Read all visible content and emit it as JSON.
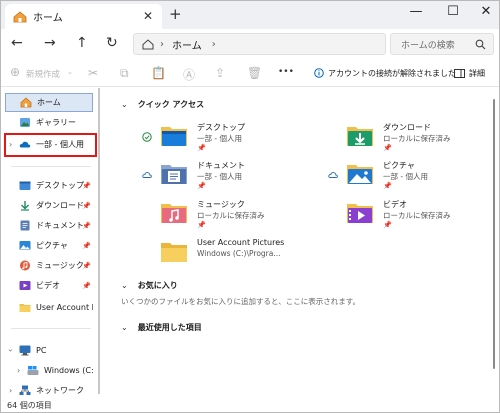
{
  "window": {
    "tab_title": "ホーム",
    "new_tab": "+",
    "minimize": "—",
    "maximize": "☐",
    "close": "✕"
  },
  "nav": {
    "back": "←",
    "forward": "→",
    "up": "↑",
    "refresh": "↻",
    "breadcrumb_root": "ホーム",
    "breadcrumb_sep": "›",
    "search_placeholder": "ホームの検索"
  },
  "command": {
    "new_label": "新規作成",
    "more": "•••",
    "status_msg": "アカウントの接続が解除されました",
    "details_label": "詳細"
  },
  "sidebar": {
    "home": "ホーム",
    "gallery": "ギャラリー",
    "onedrive": "一部 - 個人用",
    "quick": [
      {
        "label": "デスクトップ",
        "icon": "desktop-icon"
      },
      {
        "label": "ダウンロード",
        "icon": "download-icon"
      },
      {
        "label": "ドキュメント",
        "icon": "document-icon"
      },
      {
        "label": "ピクチャ",
        "icon": "picture-icon"
      },
      {
        "label": "ミュージック",
        "icon": "music-icon"
      },
      {
        "label": "ビデオ",
        "icon": "video-icon"
      },
      {
        "label": "User Account Pic",
        "icon": "folder-icon"
      }
    ],
    "pc": "PC",
    "windows_drive": "Windows (C:)",
    "network": "ネットワーク"
  },
  "main": {
    "quick_access": "クイック アクセス",
    "items": [
      {
        "name": "デスクトップ",
        "sub": "一部 - 個人用",
        "status": "check"
      },
      {
        "name": "ダウンロード",
        "sub": "ローカルに保存済み",
        "status": "none"
      },
      {
        "name": "ドキュメント",
        "sub": "一部 - 個人用",
        "status": "cloud"
      },
      {
        "name": "ピクチャ",
        "sub": "一部 - 個人用",
        "status": "cloud"
      },
      {
        "name": "ミュージック",
        "sub": "ローカルに保存済み",
        "status": "none"
      },
      {
        "name": "ビデオ",
        "sub": "ローカルに保存済み",
        "status": "none"
      },
      {
        "name": "User Account Pictures",
        "sub": "Windows (C:)\\Progra...",
        "status": "none"
      }
    ],
    "favorites": "お気に入り",
    "favorites_empty": "いくつかのファイルをお気に入りに追加すると、ここに表示されます。",
    "recent": "最近使用した項目"
  },
  "status_bar": {
    "count": "64 個の項目"
  },
  "colors": {
    "accent": "#0067c0",
    "highlight_box": "#e01818",
    "selected_bg": "#dbe7f4"
  }
}
